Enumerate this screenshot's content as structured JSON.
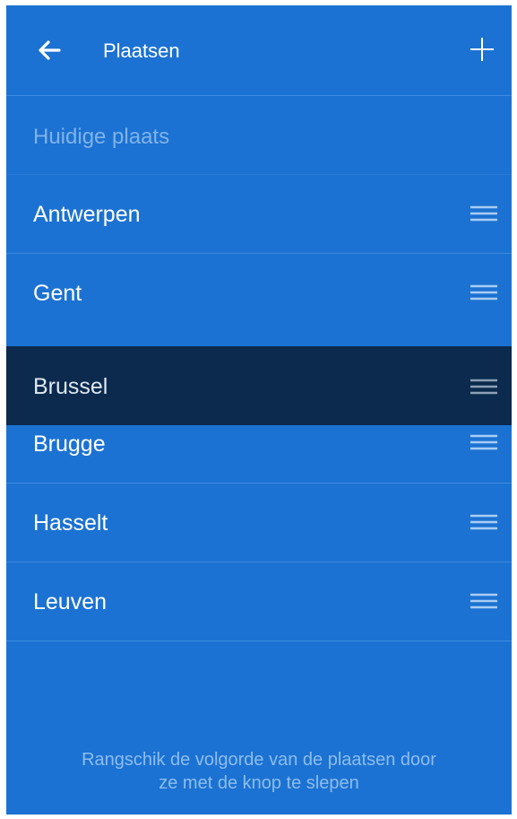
{
  "header": {
    "title": "Plaatsen",
    "back_icon": "arrow-left-icon",
    "add_icon": "plus-icon"
  },
  "current_location": {
    "label": "Huidige plaats"
  },
  "places": [
    {
      "label": "Antwerpen"
    },
    {
      "label": "Gent"
    },
    {
      "label": "Brugge"
    },
    {
      "label": "Hasselt"
    },
    {
      "label": "Leuven"
    }
  ],
  "dragging_place": {
    "label": "Brussel"
  },
  "hint": {
    "line1": "Rangschik de volgorde van de plaatsen door",
    "line2": "ze met de knop te slepen"
  },
  "colors": {
    "background": "#1c72d2",
    "dragging_row": "#0b2a4d",
    "divider": "#3b8ade",
    "muted_text": "#7fb3ea"
  }
}
